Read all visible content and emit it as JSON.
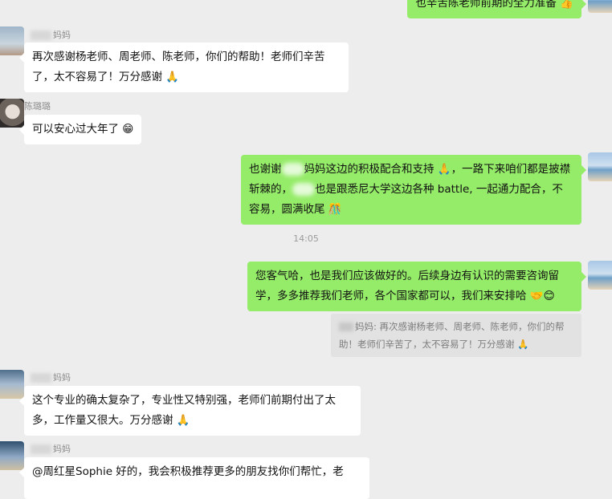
{
  "messages": {
    "top_right": {
      "text": "也辛苦陈老师前期的全力准备 👍"
    },
    "m1": {
      "sender_suffix": "妈妈",
      "text": "再次感谢杨老师、周老师、陈老师，你们的帮助！老师们辛苦了，太不容易了！万分感谢 🙏"
    },
    "m2": {
      "sender": "陈璐璐",
      "text": "可以安心过大年了 😁"
    },
    "m3": {
      "part1": "也谢谢",
      "part2": "妈妈这边的积极配合和支持 🙏，一路下来咱们都是披襟斩棘的，",
      "part3": "也是跟悉尼大学这边各种 battle, 一起通力配合，不容易，圆满收尾 🎊"
    },
    "time": "14:05",
    "m4": {
      "text": "您客气哈，也是我们应该做好的。后续身边有认识的需要咨询留学，多多推荐我们老师，各个国家都可以，我们来安排哈 🤝😊"
    },
    "quote": {
      "sender_suffix": "妈妈:",
      "text": "再次感谢杨老师、周老师、陈老师，你们的帮助！老师们辛苦了，太不容易了！万分感谢 🙏"
    },
    "m5": {
      "sender_suffix": "妈妈",
      "text": "这个专业的确太复杂了，专业性又特别强，老师们前期付出了太多，工作量又很大。万分感谢 🙏"
    },
    "m6": {
      "sender_suffix": "妈妈",
      "text": "@周红星Sophie 好的，我会积极推荐更多的朋友找你们帮忙，老"
    }
  }
}
